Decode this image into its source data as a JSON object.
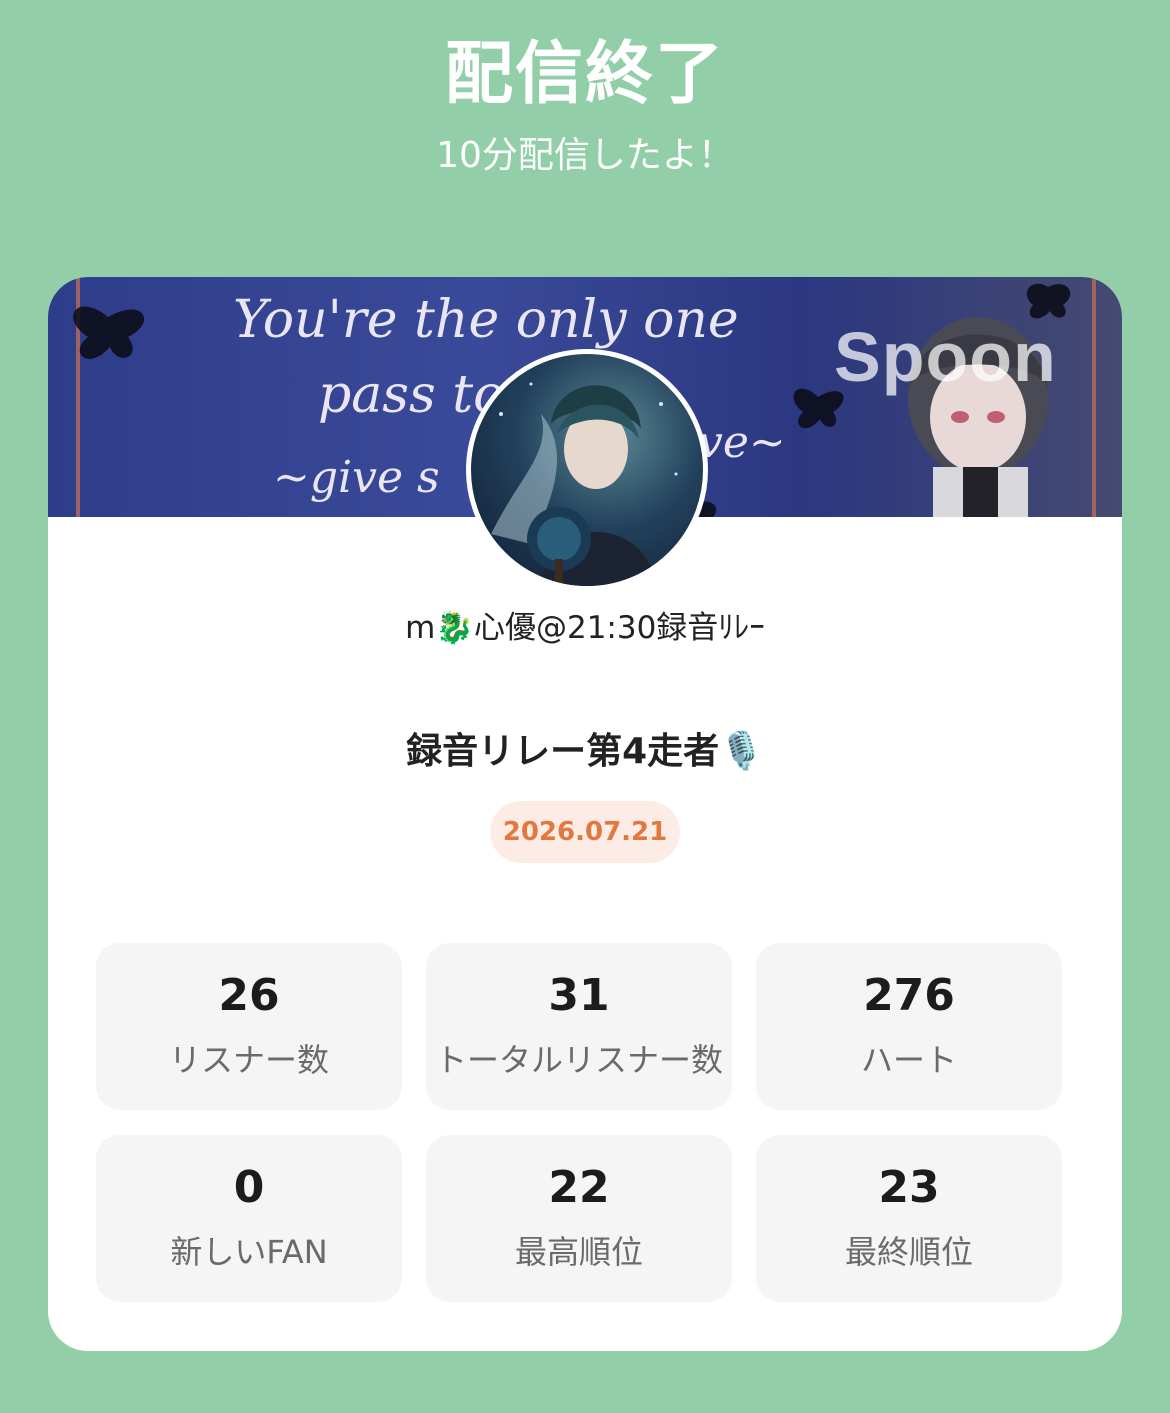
{
  "header": {
    "title": "配信終了",
    "subtitle": "10分配信したよ！"
  },
  "banner": {
    "text_line1": "You're the only one",
    "text_line2": "pass to me",
    "text_line3": "~give s",
    "text_line4": "ve~",
    "logo": "Spoon"
  },
  "profile": {
    "username": "m🐉心優@21:30録音ﾘﾚｰ"
  },
  "live": {
    "title": "録音リレー第4走者🎙️",
    "date": "2026.07.21"
  },
  "stats": [
    {
      "value": "26",
      "label": "リスナー数"
    },
    {
      "value": "31",
      "label": "トータルリスナー数"
    },
    {
      "value": "276",
      "label": "ハート"
    },
    {
      "value": "0",
      "label": "新しいFAN"
    },
    {
      "value": "22",
      "label": "最高順位"
    },
    {
      "value": "23",
      "label": "最終順位"
    }
  ],
  "colors": {
    "background": "#92cfa8",
    "card": "#ffffff",
    "date_text": "#e3783f",
    "date_bg": "#fdece5",
    "stat_bg": "#f5f5f5"
  }
}
